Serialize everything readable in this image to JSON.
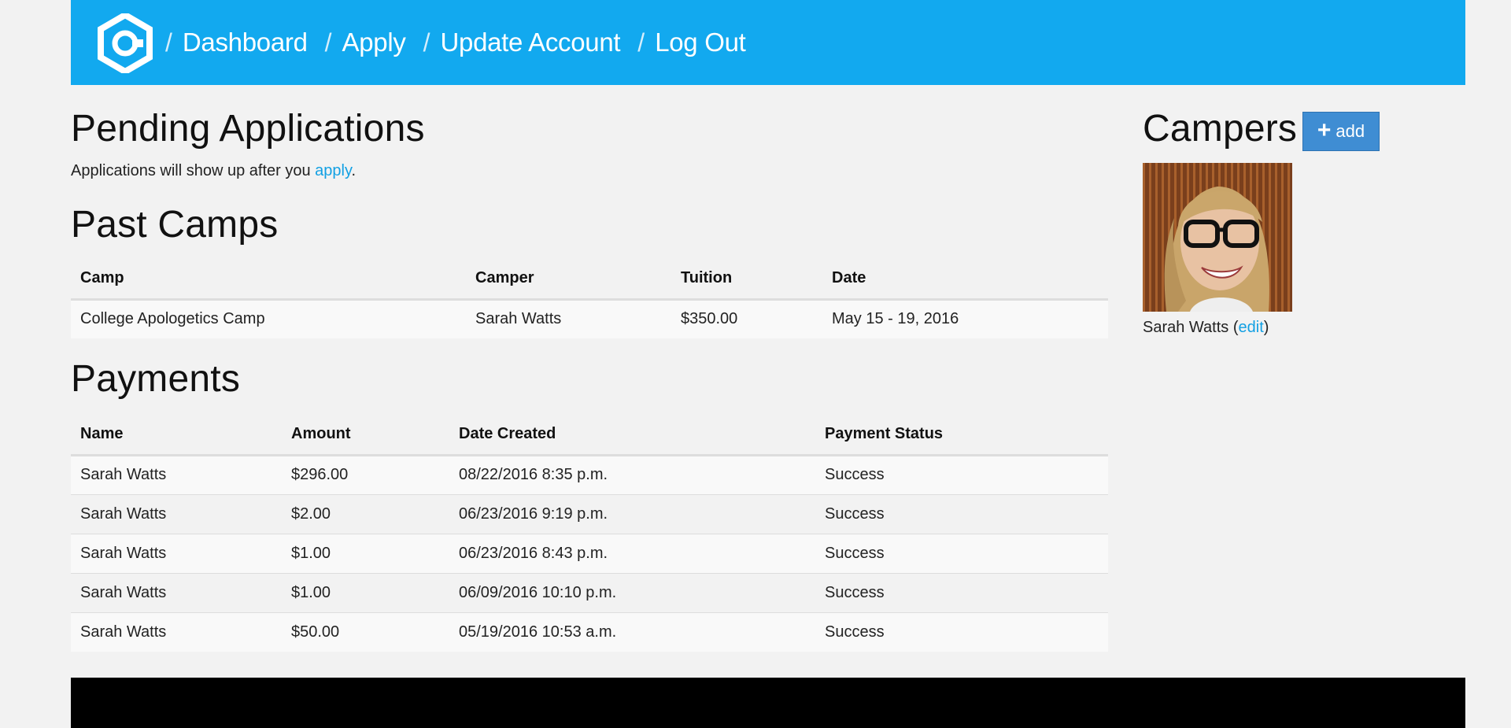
{
  "nav": {
    "links": [
      {
        "label": "Dashboard"
      },
      {
        "label": "Apply"
      },
      {
        "label": "Update Account"
      },
      {
        "label": "Log Out"
      }
    ],
    "separator": "/",
    "color": "#12a9ef"
  },
  "pending": {
    "title": "Pending Applications",
    "text_before": "Applications will show up after you ",
    "link": "apply",
    "text_after": "."
  },
  "past_camps": {
    "title": "Past Camps",
    "headers": [
      "Camp",
      "Camper",
      "Tuition",
      "Date"
    ],
    "rows": [
      [
        "College Apologetics Camp",
        "Sarah Watts",
        "$350.00",
        "May 15 - 19, 2016"
      ]
    ]
  },
  "payments": {
    "title": "Payments",
    "headers": [
      "Name",
      "Amount",
      "Date Created",
      "Payment Status"
    ],
    "rows": [
      [
        "Sarah Watts",
        "$296.00",
        "08/22/2016 8:35 p.m.",
        "Success"
      ],
      [
        "Sarah Watts",
        "$2.00",
        "06/23/2016 9:19 p.m.",
        "Success"
      ],
      [
        "Sarah Watts",
        "$1.00",
        "06/23/2016 8:43 p.m.",
        "Success"
      ],
      [
        "Sarah Watts",
        "$1.00",
        "06/09/2016 10:10 p.m.",
        "Success"
      ],
      [
        "Sarah Watts",
        "$50.00",
        "05/19/2016 10:53 a.m.",
        "Success"
      ]
    ]
  },
  "campers": {
    "title": "Campers",
    "add_label": "add",
    "list": [
      {
        "name": "Sarah Watts",
        "edit_label": "edit"
      }
    ]
  }
}
